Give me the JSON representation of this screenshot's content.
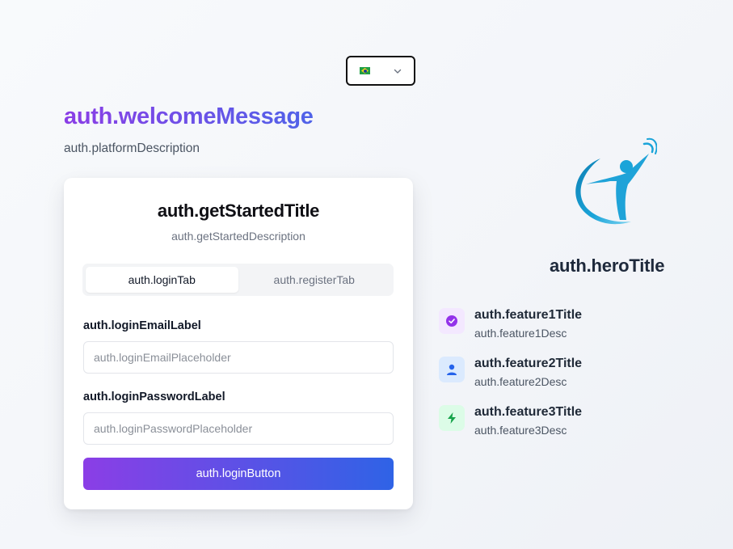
{
  "language_selector": {
    "flag": "brazil-flag-icon",
    "chevron": "chevron-down-icon"
  },
  "welcome": {
    "title": "auth.welcomeMessage",
    "description": "auth.platformDescription"
  },
  "card": {
    "title": "auth.getStartedTitle",
    "description": "auth.getStartedDescription",
    "tabs": [
      {
        "label": "auth.loginTab",
        "active": true
      },
      {
        "label": "auth.registerTab",
        "active": false
      }
    ],
    "email": {
      "label": "auth.loginEmailLabel",
      "placeholder": "auth.loginEmailPlaceholder",
      "value": ""
    },
    "password": {
      "label": "auth.loginPasswordLabel",
      "placeholder": "auth.loginPasswordPlaceholder",
      "value": ""
    },
    "login_button": "auth.loginButton"
  },
  "hero": {
    "title": "auth.heroTitle",
    "features": [
      {
        "title": "auth.feature1Title",
        "desc": "auth.feature1Desc",
        "icon": "check-circle-icon",
        "color": "#9333ea",
        "bg": "#f3e8ff"
      },
      {
        "title": "auth.feature2Title",
        "desc": "auth.feature2Desc",
        "icon": "user-icon",
        "color": "#2563eb",
        "bg": "#dbeafe"
      },
      {
        "title": "auth.feature3Title",
        "desc": "auth.feature3Desc",
        "icon": "lightning-icon",
        "color": "#16a34a",
        "bg": "#dcfce7"
      }
    ]
  },
  "colors": {
    "gradient_start": "#8b3ee6",
    "gradient_end": "#2f63e6",
    "logo_blue": "#1aa4d9"
  }
}
